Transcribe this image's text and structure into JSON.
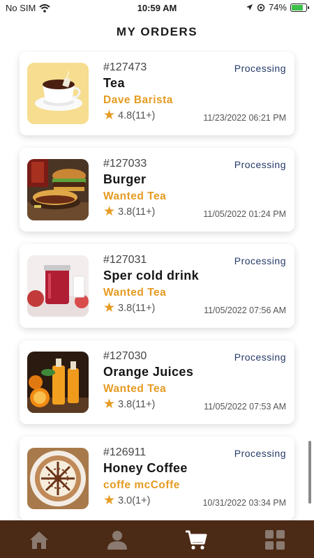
{
  "status_bar": {
    "carrier": "No SIM",
    "time": "10:59 AM",
    "battery": "74%"
  },
  "header": {
    "title": "MY ORDERS"
  },
  "orders": [
    {
      "id": "#127473",
      "name": "Tea",
      "shop": "Dave Barista",
      "status": "Processing",
      "rating": "4.8(11+)",
      "date": "11/23/2022 06:21 PM",
      "image": "tea-cup-image"
    },
    {
      "id": "#127033",
      "name": "Burger",
      "shop": "Wanted Tea",
      "status": "Processing",
      "rating": "3.8(11+)",
      "date": "11/05/2022 01:24 PM",
      "image": "burger-image"
    },
    {
      "id": "#127031",
      "name": "Sper cold drink",
      "shop": "Wanted Tea",
      "status": "Processing",
      "rating": "3.8(11+)",
      "date": "11/05/2022 07:56 AM",
      "image": "cold-drink-image"
    },
    {
      "id": "#127030",
      "name": "Orange Juices",
      "shop": "Wanted Tea",
      "status": "Processing",
      "rating": "3.8(11+)",
      "date": "11/05/2022 07:53 AM",
      "image": "orange-juice-image"
    },
    {
      "id": "#126911",
      "name": "Honey Coffee",
      "shop": "coffe mcCoffe",
      "status": "Processing",
      "rating": "3.0(1+)",
      "date": "10/31/2022 03:34 PM",
      "image": "latte-art-image"
    }
  ],
  "tab_bar": {
    "tabs": [
      "home-icon",
      "profile-icon",
      "cart-icon",
      "grid-menu-icon"
    ],
    "active": "cart-icon"
  },
  "colors": {
    "accent": "#e59b22",
    "status": "#253968",
    "tab_bar": "#4b2a16",
    "active_tab": "#ffffff",
    "inactive_tab": "#8a7a70"
  }
}
